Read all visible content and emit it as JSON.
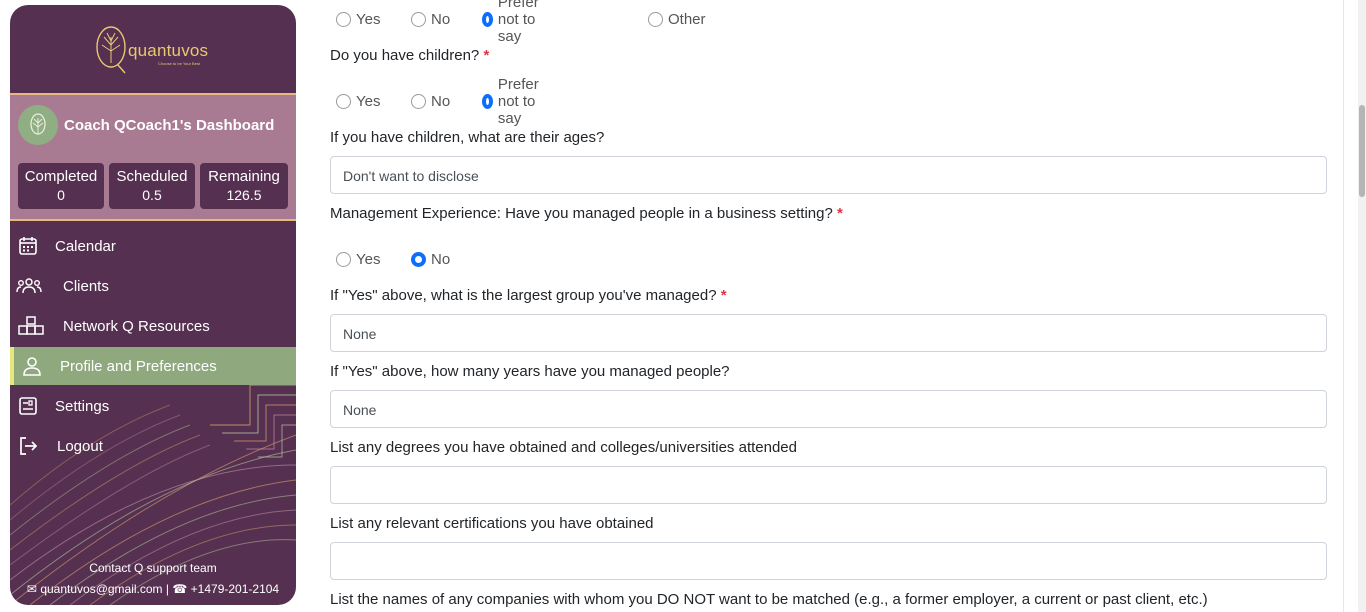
{
  "brand": {
    "name": "quantuvos",
    "tagline": "Choose to be Your Best"
  },
  "coach": {
    "title": "Coach QCoach1's Dashboard",
    "stats": [
      {
        "label": "Completed",
        "value": "0"
      },
      {
        "label": "Scheduled",
        "value": "0.5"
      },
      {
        "label": "Remaining",
        "value": "126.5"
      }
    ]
  },
  "nav": [
    {
      "label": "Calendar",
      "icon": "calendar-icon"
    },
    {
      "label": "Clients",
      "icon": "users-icon"
    },
    {
      "label": "Network Q Resources",
      "icon": "network-icon"
    },
    {
      "label": "Profile and Preferences",
      "icon": "user-icon",
      "active": true
    },
    {
      "label": "Settings",
      "icon": "settings-icon"
    },
    {
      "label": "Logout",
      "icon": "logout-icon"
    }
  ],
  "support": {
    "title": "Contact Q support team",
    "email": "quantuvos@gmail.com",
    "separator": "|",
    "phone": "+1479-201-2104"
  },
  "form": {
    "row0": {
      "options": [
        "Yes",
        "No",
        "Prefer not to say",
        "Other"
      ],
      "selected": "Prefer not to say"
    },
    "children": {
      "question": "Do you have children?",
      "required": "*",
      "options": [
        "Yes",
        "No",
        "Prefer not to say"
      ],
      "selected": "Prefer not to say"
    },
    "ages": {
      "question": "If you have children, what are their ages?",
      "value": "Don't want to disclose"
    },
    "management": {
      "question": "Management Experience: Have you managed people in a business setting?",
      "required": "*",
      "options": [
        "Yes",
        "No"
      ],
      "selected": "No"
    },
    "largest_group": {
      "question": "If \"Yes\" above, what is the largest group you've managed?",
      "required": "*",
      "value": "None"
    },
    "years_managed": {
      "question": "If \"Yes\" above, how many years have you managed people?",
      "value": "None"
    },
    "degrees": {
      "question": "List any degrees you have obtained and colleges/universities attended",
      "value": ""
    },
    "certifications": {
      "question": "List any relevant certifications you have obtained",
      "value": ""
    },
    "companies": {
      "question": "List the names of any companies with whom you DO NOT want to be matched (e.g., a former employer, a current or past client, etc.)"
    }
  },
  "colors": {
    "sidebar": "#553050",
    "coach_panel": "#a87b92",
    "active_nav": "#8fa87e",
    "accent_gold": "#e8c874",
    "radio_selected": "#0d6efd",
    "required": "#dc3545"
  }
}
